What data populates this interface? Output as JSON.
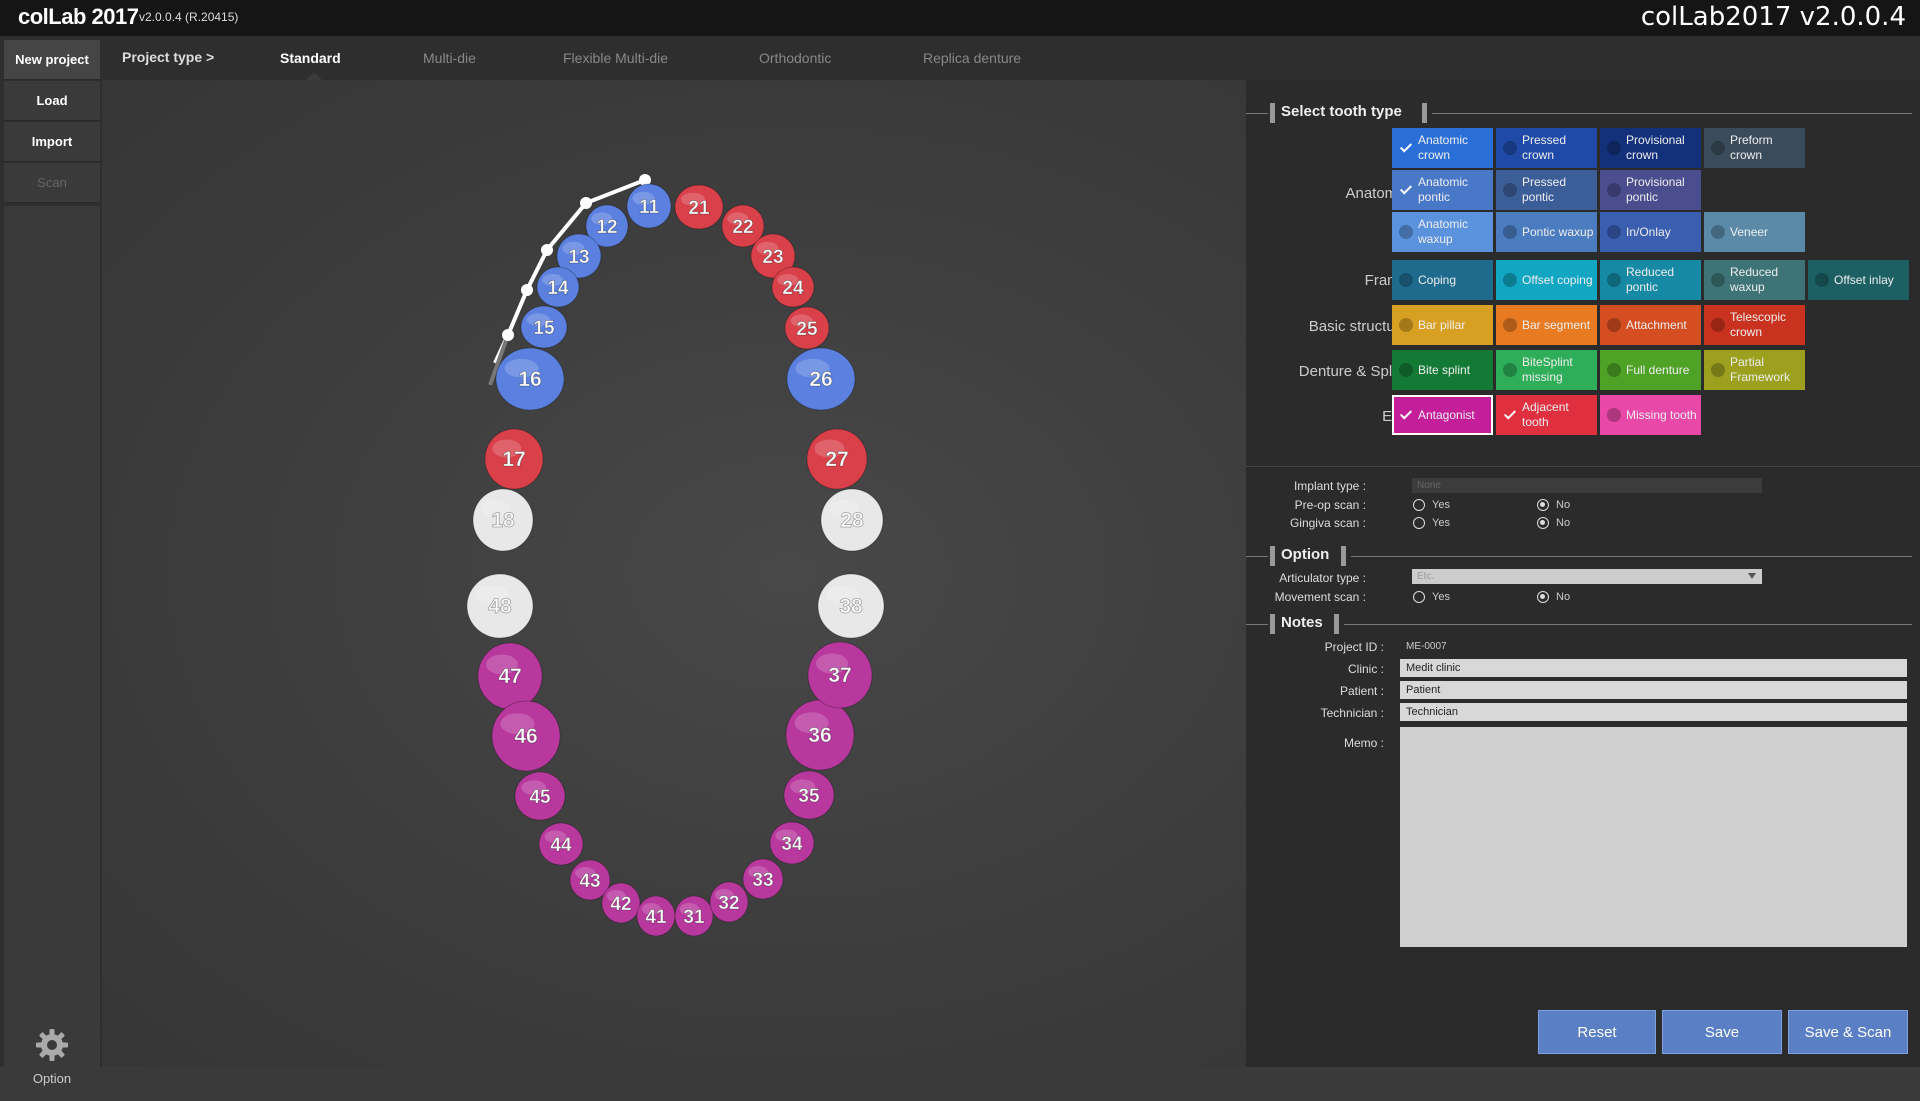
{
  "titlebar": {
    "logo": "colLab 2017",
    "version": "v2.0.0.4  (R.20415)",
    "window_title": "colLab2017 v2.0.0.4"
  },
  "sidebar": {
    "new_project": "New project",
    "load": "Load",
    "import": "Import",
    "scan": "Scan",
    "option": "Option"
  },
  "tabs": {
    "project_type": "Project type >",
    "items": [
      "Standard",
      "Multi-die",
      "Flexible Multi-die",
      "Orthodontic",
      "Replica denture"
    ],
    "active": "Standard"
  },
  "teeth": {
    "colors": {
      "blue": "#5b80e0",
      "red": "#d9404a",
      "white": "#e8e8e8",
      "magenta": "#b8389e"
    },
    "upper": [
      {
        "n": "11",
        "c": "blue"
      },
      {
        "n": "12",
        "c": "blue"
      },
      {
        "n": "13",
        "c": "blue"
      },
      {
        "n": "14",
        "c": "blue"
      },
      {
        "n": "15",
        "c": "blue"
      },
      {
        "n": "16",
        "c": "blue"
      },
      {
        "n": "17",
        "c": "red"
      },
      {
        "n": "18",
        "c": "white"
      },
      {
        "n": "21",
        "c": "red"
      },
      {
        "n": "22",
        "c": "red"
      },
      {
        "n": "23",
        "c": "red"
      },
      {
        "n": "24",
        "c": "red"
      },
      {
        "n": "25",
        "c": "red"
      },
      {
        "n": "26",
        "c": "blue"
      },
      {
        "n": "27",
        "c": "red"
      },
      {
        "n": "28",
        "c": "white"
      }
    ],
    "lower": [
      {
        "n": "48",
        "c": "white"
      },
      {
        "n": "47",
        "c": "magenta"
      },
      {
        "n": "46",
        "c": "magenta"
      },
      {
        "n": "45",
        "c": "magenta"
      },
      {
        "n": "44",
        "c": "magenta"
      },
      {
        "n": "43",
        "c": "magenta"
      },
      {
        "n": "42",
        "c": "magenta"
      },
      {
        "n": "41",
        "c": "magenta"
      },
      {
        "n": "31",
        "c": "magenta"
      },
      {
        "n": "32",
        "c": "magenta"
      },
      {
        "n": "33",
        "c": "magenta"
      },
      {
        "n": "34",
        "c": "magenta"
      },
      {
        "n": "35",
        "c": "magenta"
      },
      {
        "n": "36",
        "c": "magenta"
      },
      {
        "n": "37",
        "c": "magenta"
      },
      {
        "n": "38",
        "c": "white"
      }
    ]
  },
  "tooth_type": {
    "title": "Select tooth type",
    "rows": [
      {
        "label": "Anatomic",
        "buttons": [
          {
            "text": "Anatomic crown",
            "color": "#2a6fd8",
            "checked": true
          },
          {
            "text": "Pressed crown",
            "color": "#1f4aa8",
            "checked": false
          },
          {
            "text": "Provisional crown",
            "color": "#13307a",
            "checked": false
          },
          {
            "text": "Preform crown",
            "color": "#3a4c5c",
            "checked": false
          }
        ]
      },
      {
        "label": "",
        "buttons": [
          {
            "text": "Anatomic pontic",
            "color": "#4a78c8",
            "checked": true
          },
          {
            "text": "Pressed pontic",
            "color": "#3c5e98",
            "checked": false
          },
          {
            "text": "Provisional pontic",
            "color": "#4a4e8e",
            "checked": false
          }
        ]
      },
      {
        "label": "",
        "buttons": [
          {
            "text": "Anatomic waxup",
            "color": "#5b92de",
            "checked": false
          },
          {
            "text": "Pontic waxup",
            "color": "#4c7cc0",
            "checked": false
          },
          {
            "text": "In/Onlay",
            "color": "#3a5eb0",
            "checked": false
          },
          {
            "text": "Veneer",
            "color": "#5a8aa8",
            "checked": false
          }
        ]
      },
      {
        "label": "Frame",
        "buttons": [
          {
            "text": "Coping",
            "color": "#1e6b8e",
            "checked": false
          },
          {
            "text": "Offset coping",
            "color": "#11a6c2",
            "checked": false
          },
          {
            "text": "Reduced pontic",
            "color": "#1689a4",
            "checked": false
          },
          {
            "text": "Reduced waxup",
            "color": "#3e7478",
            "checked": false
          },
          {
            "text": "Offset inlay",
            "color": "#1c6064",
            "checked": false
          }
        ]
      },
      {
        "label": "Basic structure",
        "buttons": [
          {
            "text": "Bar pillar",
            "color": "#d8a022",
            "checked": false
          },
          {
            "text": "Bar segment",
            "color": "#e87a22",
            "checked": false
          },
          {
            "text": "Attachment",
            "color": "#d44e22",
            "checked": false
          },
          {
            "text": "Telescopic crown",
            "color": "#c8321e",
            "checked": false
          }
        ]
      },
      {
        "label": "Denture & Splint",
        "buttons": [
          {
            "text": "Bite splint",
            "color": "#137a36",
            "checked": false
          },
          {
            "text": "BiteSplint missing",
            "color": "#2eae58",
            "checked": false
          },
          {
            "text": "Full denture",
            "color": "#4ea226",
            "checked": false
          },
          {
            "text": "Partial Framework",
            "color": "#9ca01e",
            "checked": false
          }
        ]
      },
      {
        "label": "Etc.",
        "buttons": [
          {
            "text": "Antagonist",
            "color": "#c41e9a",
            "checked": true,
            "selected": true
          },
          {
            "text": "Adjacent tooth",
            "color": "#e03040",
            "checked": true
          },
          {
            "text": "Missing tooth",
            "color": "#e848a8",
            "checked": false
          }
        ]
      }
    ]
  },
  "implant": {
    "implant_type_label": "Implant type :",
    "implant_type_value": "None",
    "preop_label": "Pre-op scan :",
    "gingiva_label": "Gingiva scan :",
    "yes": "Yes",
    "no": "No"
  },
  "option": {
    "title": "Option",
    "articulator_label": "Articulator type :",
    "articulator_value": "Etc.",
    "movement_label": "Movement scan :",
    "yes": "Yes",
    "no": "No"
  },
  "notes": {
    "title": "Notes",
    "project_id_label": "Project ID :",
    "project_id": "ME-0007",
    "clinic_label": "Clinic :",
    "clinic": "Medit clinic",
    "patient_label": "Patient :",
    "patient": "Patient",
    "technician_label": "Technician :",
    "technician": "Technician",
    "memo_label": "Memo :"
  },
  "actions": {
    "reset": "Reset",
    "save": "Save",
    "save_scan": "Save & Scan"
  }
}
